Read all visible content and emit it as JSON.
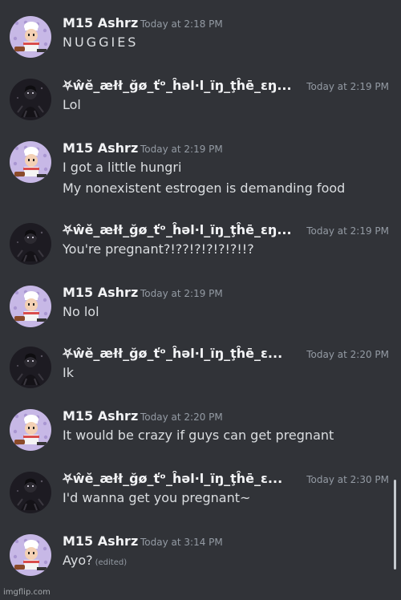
{
  "messages": [
    {
      "author": "M15 Ashrz",
      "time": "Today at 2:18 PM",
      "text": "NUGGIES",
      "avatar": "chef-avatar-icon"
    },
    {
      "author": "⛧ŵĕ_æłł_ğø_ťᵒ_ĥəl·l_ïŋ_ţĥē_εŋ...",
      "time": "Today at 2:19 PM",
      "text": "Lol",
      "avatar": "dark-figure-avatar-icon"
    },
    {
      "author": "M15 Ashrz",
      "time": "Today at 2:19 PM",
      "text": "I got a little hungri",
      "text2": "My nonexistent estrogen is demanding food",
      "avatar": "chef-avatar-icon"
    },
    {
      "author": "⛧ŵĕ_æłł_ğø_ťᵒ_ĥəl·l_ïŋ_ţĥē_εŋ...",
      "time": "Today at 2:19 PM",
      "text": "You're pregnant?!??!?!?!?!?!!?",
      "avatar": "dark-figure-avatar-icon"
    },
    {
      "author": "M15 Ashrz",
      "time": "Today at 2:19 PM",
      "text": "No lol",
      "avatar": "chef-avatar-icon"
    },
    {
      "author": "⛧ŵĕ_æłł_ğø_ťᵒ_ĥəl·l_ïŋ_ţĥē_ε...",
      "time": "Today at 2:20 PM",
      "text": "Ik",
      "avatar": "dark-figure-avatar-icon"
    },
    {
      "author": "M15 Ashrz",
      "time": "Today at 2:20 PM",
      "text": "It would be crazy if guys can get pregnant",
      "avatar": "chef-avatar-icon"
    },
    {
      "author": "⛧ŵĕ_æłł_ğø_ťᵒ_ĥəl·l_ïŋ_ţĥē_ε...",
      "time": "Today at 2:30 PM",
      "text": "I'd wanna get you pregnant~",
      "avatar": "dark-figure-avatar-icon"
    },
    {
      "author": "M15 Ashrz",
      "time": "Today at 3:14 PM",
      "text": "Ayo?",
      "edited": "(edited)",
      "avatar": "chef-avatar-icon"
    }
  ],
  "watermark": "imgflip.com",
  "colors": {
    "background": "#313338",
    "author": "#f2f3f5",
    "text": "#dbdee1",
    "timestamp": "#949ba4",
    "chef_avatar_bg": "#c7b8e6",
    "dark_avatar_bg": "#1d1b22"
  }
}
